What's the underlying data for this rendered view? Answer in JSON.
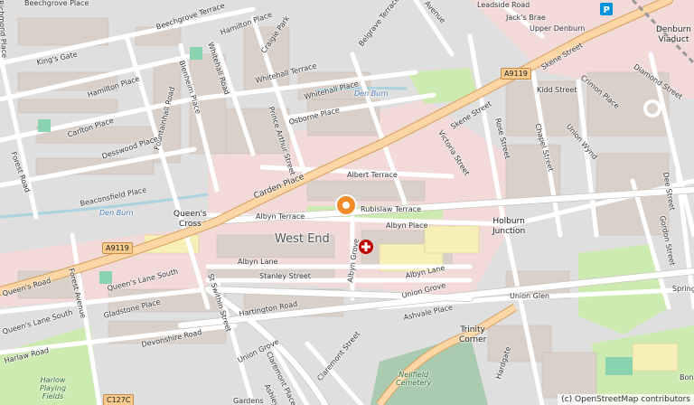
{
  "map": {
    "place_name": "West End",
    "attribution": "(c) OpenStreetMap contributors",
    "areas": {
      "queens_cross": [
        "Queen's",
        "Cross"
      ],
      "holburn_junction": [
        "Holburn",
        "Junction"
      ],
      "trinity_corner": [
        "Trinity",
        "Corner"
      ],
      "denburn_viaduct": [
        "Denburn",
        "Viaduct"
      ]
    },
    "green_spaces": {
      "harlow_playing_fields": [
        "Harlow",
        "Playing",
        "Fields"
      ],
      "nellfield_cemetery": [
        "Nellfield",
        "Cemetery"
      ]
    },
    "waterways": {
      "den_burn_west": "Den Burn",
      "den_burn_east": "Den Burn"
    },
    "route_shields": {
      "a9119_west": "A9119",
      "a9119_east": "A9119",
      "c127c": "C127C"
    },
    "streets": {
      "beechgrove_place": "Beechgrove Place",
      "beechgrove_terrace": "Beechgrove Terrace",
      "kings_gate": "King's Gate",
      "hamilton_place_n": "Hamilton Place",
      "hamilton_place_w": "Hamilton Place",
      "fountainhall_road": "Fountainhall Road",
      "carlton_place": "Carlton Place",
      "desswood_place": "Desswood Place",
      "beaconsfield_place": "Beaconsfield Place",
      "forest_road": "Forest Road",
      "whitehall_road": "Whitehall Road",
      "blenheim_place": "Blenheim Place",
      "craigie_park": "Craigie Park",
      "whitehall_terrace": "Whitehall Terrace",
      "whitehall_place": "Whitehall Place",
      "belgrave_terrace": "Belgrave Terrace",
      "osborne_place": "Osborne Place",
      "prince_arthur_street": "Prince Arthur Street",
      "carden_place": "Carden Place",
      "albert_terrace": "Albert Terrace",
      "rubislaw_terrace": "Rubislaw Terrace",
      "albyn_terrace": "Albyn Terrace",
      "albyn_place": "Albyn Place",
      "skene_street": "Skene Street",
      "upper_denburn": "Upper Denburn",
      "leadside_road": "Leadside Road",
      "jacks_brae": "Jack's Brae",
      "kidd_street": "Kidd Street",
      "crimon_place": "Crimon Place",
      "diamond_street": "Diamond Street",
      "chapel_street": "Chapel Street",
      "union_wynd": "Union Wynd",
      "rose_street": "Rose Street",
      "victoria_street": "Victoria Street",
      "dee_street": "Dee Street",
      "gordon_street": "Gordon Street",
      "queens_road": "Queen's Road",
      "queens_lane_south": "Queen's Lane South",
      "queens_lane_south_w": "Queen's Lane South",
      "forest_avenue": "Forest Avenue",
      "gladstone_place": "Gladstone Place",
      "devonshire_road": "Devonshire Road",
      "harlaw_road": "Harlaw Road",
      "st_swithin_street": "St Swithin Street",
      "hartington_road": "Hartington Road",
      "albyn_lane_w": "Albyn Lane",
      "albyn_lane_e": "Albyn Lane",
      "stanley_street": "Stanley Street",
      "albyn_grove": "Albyn Grove",
      "union_grove_e": "Union Grove",
      "union_grove_w": "Union Grove",
      "union_glen": "Union Glen",
      "ashvale_place": "Ashvale Place",
      "claremont_street": "Claremont Street",
      "claremont_place": "Claremont Place",
      "ashley_road": "Ashley",
      "springbank": "Spring",
      "bon_accord": "Bon",
      "hardgate": "Hardgate",
      "avenue": "Avenue",
      "richmond_place": "Richmond Place",
      "gardens": "Gardens"
    },
    "colors": {
      "background": "#f2efe9",
      "residential": "#e0dfdf",
      "commercial": "#f2dad9",
      "park": "#cdebb0",
      "cemetery": "#aacbaf",
      "water": "#aad3df",
      "primary_road": "#fcd6a4",
      "primary_casing": "#d79f5c",
      "minor_road": "#ffffff",
      "building": "#d9d0c9",
      "hospital": "#bf0000",
      "viewpoint": "#f28c29"
    }
  }
}
